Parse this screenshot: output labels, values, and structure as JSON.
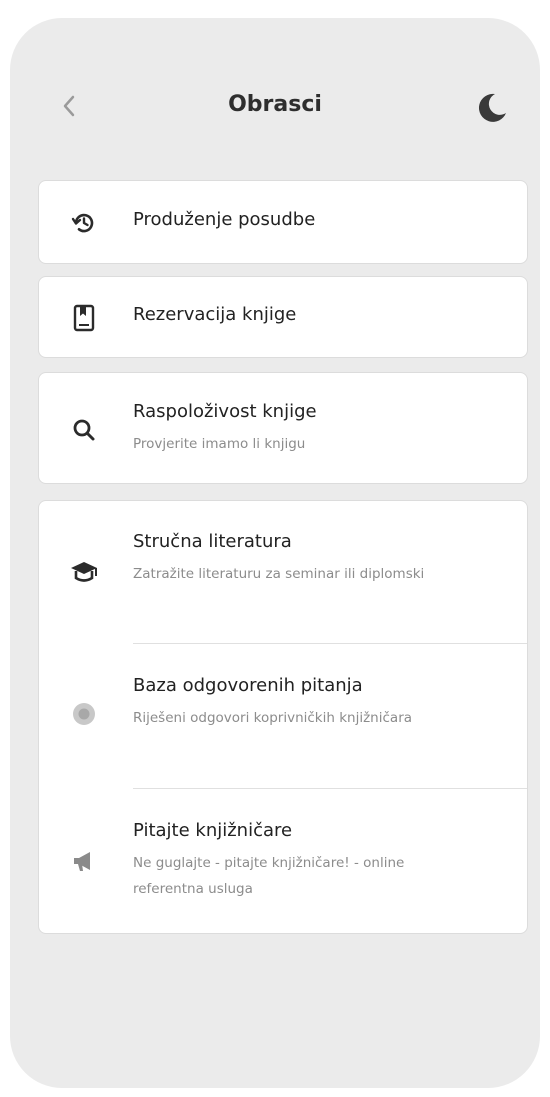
{
  "header": {
    "title": "Obrasci"
  },
  "menu": {
    "renewal": {
      "label": "Produženje posudbe"
    },
    "reservation": {
      "label": "Rezervacija knjige"
    },
    "availability": {
      "label": "Raspoloživost knjige",
      "subtitle": "Provjerite imamo li knjigu"
    },
    "literature": {
      "label": "Stručna literatura",
      "subtitle": "Zatražite literaturu za seminar ili diplomski"
    },
    "answers": {
      "label": "Baza odgovorenih pitanja",
      "subtitle": "Riješeni odgovori koprivničkih knjižničara"
    },
    "ask": {
      "label": "Pitajte knjižničare",
      "subtitle": "Ne guglajte - pitajte knjižničare! - online referentna usluga"
    }
  }
}
